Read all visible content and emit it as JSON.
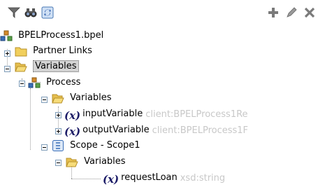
{
  "toolbar": {
    "left": [
      {
        "name": "filter-icon"
      },
      {
        "name": "find-icon"
      },
      {
        "name": "refresh-icon"
      }
    ],
    "right": [
      {
        "name": "add-icon"
      },
      {
        "name": "edit-icon"
      },
      {
        "name": "delete-icon"
      }
    ]
  },
  "tree": {
    "root": "BPELProcess1.bpel",
    "partner_links": "Partner Links",
    "variables": "Variables",
    "process": "Process",
    "process_variables": "Variables",
    "input_variable": "inputVariable",
    "input_variable_type": "client:BPELProcess1Re",
    "output_variable": "outputVariable",
    "output_variable_type": "client:BPELProcess1F",
    "scope": "Scope - Scope1",
    "scope_variables": "Variables",
    "request_loan": "requestLoan",
    "request_loan_type": "xsd:string"
  }
}
